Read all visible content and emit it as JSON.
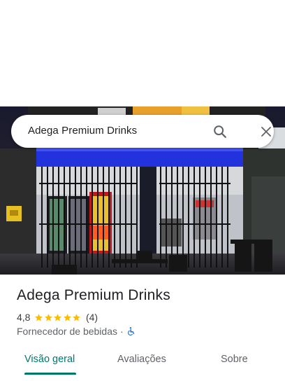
{
  "search": {
    "query": "Adega Premium Drinks"
  },
  "place": {
    "name": "Adega Premium Drinks",
    "rating": "4,8",
    "stars": 5,
    "review_count": "(4)",
    "category": "Fornecedor de bebidas",
    "separator": "·"
  },
  "tabs": [
    {
      "label": "Visão geral",
      "active": true
    },
    {
      "label": "Avaliações",
      "active": false
    },
    {
      "label": "Sobre",
      "active": false
    }
  ],
  "colors": {
    "accent": "#00796b",
    "star": "#fbbc04",
    "accessible": "#1a73e8"
  }
}
